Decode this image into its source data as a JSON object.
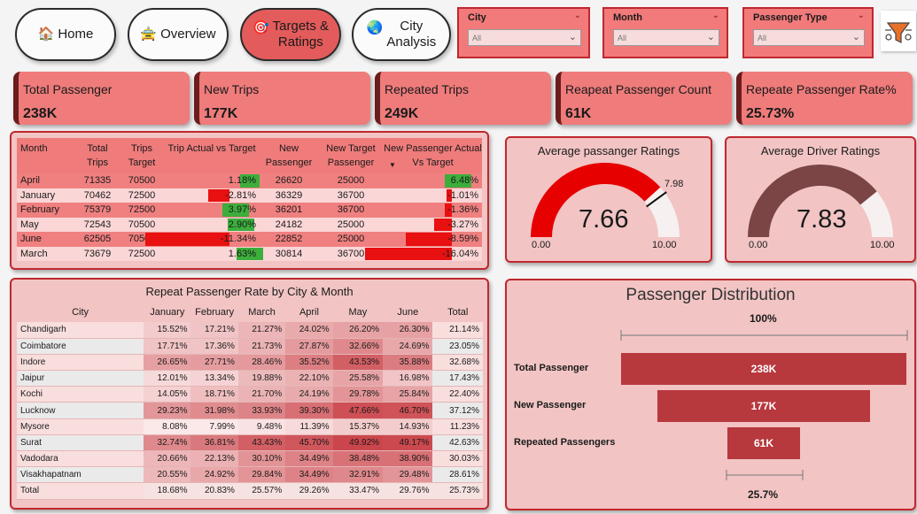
{
  "nav": {
    "home": "Home",
    "overview": "Overview",
    "targets_line1": "Targets &",
    "targets_line2": "Ratings",
    "city_line1": "City",
    "city_line2": "Analysis"
  },
  "filters": {
    "city": {
      "label": "City",
      "value": "All"
    },
    "month": {
      "label": "Month",
      "value": "All"
    },
    "passenger_type": {
      "label": "Passenger Type",
      "value": "All"
    }
  },
  "kpis": [
    {
      "label": "Total Passenger",
      "value": "238K"
    },
    {
      "label": "New Trips",
      "value": "177K"
    },
    {
      "label": "Repeated Trips",
      "value": "249K"
    },
    {
      "label": "Reapeat Passenger Count",
      "value": "61K"
    },
    {
      "label": "Repeate Passenger Rate%",
      "value": "25.73%"
    }
  ],
  "trips_table": {
    "headers": [
      "Month",
      "Total Trips",
      "Trips Target",
      "Trip Actual vs Target",
      "New Passenger",
      "New Target Passenger",
      "New Passenger Actual Vs Target"
    ],
    "rows": [
      {
        "month": "April",
        "total": "71335",
        "target": "70500",
        "trip_avt": "1.18%",
        "trip_avt_num": 1.18,
        "new_pass": "26620",
        "new_target": "25000",
        "new_avt": "6.48%",
        "new_avt_num": 6.48
      },
      {
        "month": "January",
        "total": "70462",
        "target": "72500",
        "trip_avt": "-2.81%",
        "trip_avt_num": -2.81,
        "new_pass": "36329",
        "new_target": "36700",
        "new_avt": "-1.01%",
        "new_avt_num": -1.01
      },
      {
        "month": "February",
        "total": "75379",
        "target": "72500",
        "trip_avt": "3.97%",
        "trip_avt_num": 3.97,
        "new_pass": "36201",
        "new_target": "36700",
        "new_avt": "-1.36%",
        "new_avt_num": -1.36
      },
      {
        "month": "May",
        "total": "72543",
        "target": "70500",
        "trip_avt": "2.90%",
        "trip_avt_num": 2.9,
        "new_pass": "24182",
        "new_target": "25000",
        "new_avt": "-3.27%",
        "new_avt_num": -3.27
      },
      {
        "month": "June",
        "total": "62505",
        "target": "70500",
        "trip_avt": "-11.34%",
        "trip_avt_num": -11.34,
        "new_pass": "22852",
        "new_target": "25000",
        "new_avt": "-8.59%",
        "new_avt_num": -8.59
      },
      {
        "month": "March",
        "total": "73679",
        "target": "72500",
        "trip_avt": "1.63%",
        "trip_avt_num": 1.63,
        "new_pass": "30814",
        "new_target": "36700",
        "new_avt": "-16.04%",
        "new_avt_num": -16.04
      }
    ],
    "positive_color": "#3cae3c",
    "negative_color": "#e81010"
  },
  "gauges": [
    {
      "title": "Average passanger Ratings",
      "value": "7.66",
      "value_num": 7.66,
      "target": "7.98",
      "target_num": 7.98,
      "min": "0.00",
      "max": "10.00",
      "color": "#e60000"
    },
    {
      "title": "Average Driver Ratings",
      "value": "7.83",
      "value_num": 7.83,
      "min": "0.00",
      "max": "10.00",
      "color": "#7b4545"
    }
  ],
  "matrix": {
    "title": "Repeat Passenger Rate by City & Month",
    "headers": [
      "City",
      "January",
      "February",
      "March",
      "April",
      "May",
      "June",
      "Total"
    ],
    "rows": [
      {
        "city": "Chandigarh",
        "vals": [
          "15.52%",
          "17.21%",
          "21.27%",
          "24.02%",
          "26.20%",
          "26.30%",
          "21.14%"
        ]
      },
      {
        "city": "Coimbatore",
        "vals": [
          "17.71%",
          "17.36%",
          "21.73%",
          "27.87%",
          "32.66%",
          "24.69%",
          "23.05%"
        ]
      },
      {
        "city": "Indore",
        "vals": [
          "26.65%",
          "27.71%",
          "28.46%",
          "35.52%",
          "43.53%",
          "35.88%",
          "32.68%"
        ]
      },
      {
        "city": "Jaipur",
        "vals": [
          "12.01%",
          "13.34%",
          "19.88%",
          "22.10%",
          "25.58%",
          "16.98%",
          "17.43%"
        ]
      },
      {
        "city": "Kochi",
        "vals": [
          "14.05%",
          "18.71%",
          "21.70%",
          "24.19%",
          "29.78%",
          "25.84%",
          "22.40%"
        ]
      },
      {
        "city": "Lucknow",
        "vals": [
          "29.23%",
          "31.98%",
          "33.93%",
          "39.30%",
          "47.66%",
          "46.70%",
          "37.12%"
        ]
      },
      {
        "city": "Mysore",
        "vals": [
          "8.08%",
          "7.99%",
          "9.48%",
          "11.39%",
          "15.37%",
          "14.93%",
          "11.23%"
        ]
      },
      {
        "city": "Surat",
        "vals": [
          "32.74%",
          "36.81%",
          "43.43%",
          "45.70%",
          "49.92%",
          "49.17%",
          "42.63%"
        ]
      },
      {
        "city": "Vadodara",
        "vals": [
          "20.66%",
          "22.13%",
          "30.10%",
          "34.49%",
          "38.48%",
          "38.90%",
          "30.03%"
        ]
      },
      {
        "city": "Visakhapatnam",
        "vals": [
          "20.55%",
          "24.92%",
          "29.84%",
          "34.49%",
          "32.91%",
          "29.48%",
          "28.61%"
        ]
      }
    ],
    "total": {
      "city": "Total",
      "vals": [
        "18.68%",
        "20.83%",
        "25.57%",
        "29.26%",
        "33.47%",
        "29.76%",
        "25.73%"
      ]
    }
  },
  "funnel": {
    "title": "Passenger Distribution",
    "top_pct": "100%",
    "bottom_pct": "25.7%",
    "stages": [
      {
        "label": "Total Passenger",
        "value": "238K",
        "num": 238
      },
      {
        "label": "New Passenger",
        "value": "177K",
        "num": 177
      },
      {
        "label": "Repeated Passengers",
        "value": "61K",
        "num": 61
      }
    ],
    "bar_color": "#b7383d"
  }
}
